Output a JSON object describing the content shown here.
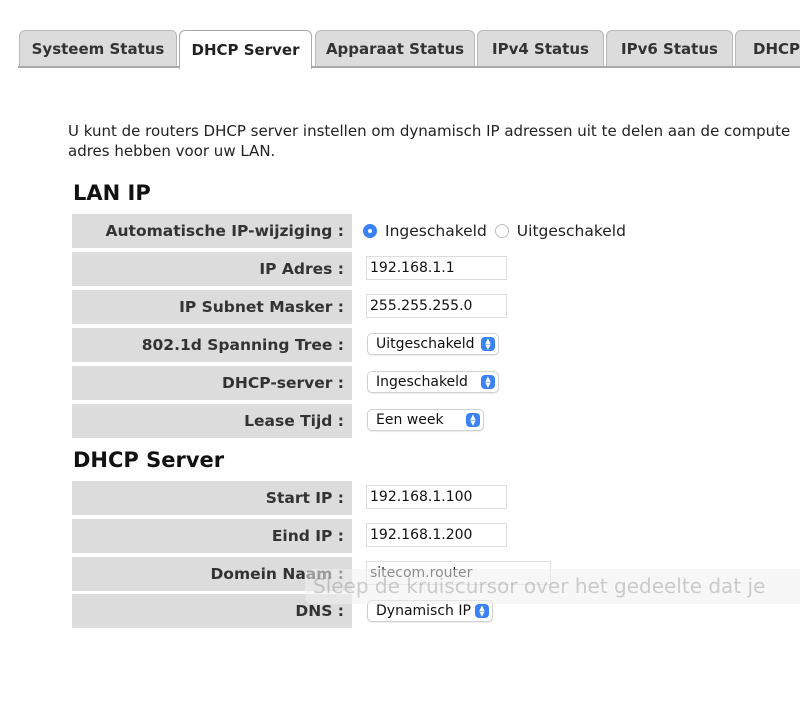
{
  "tabs": [
    {
      "label": "Systeem Status",
      "active": false
    },
    {
      "label": "DHCP Server",
      "active": true
    },
    {
      "label": "Apparaat Status",
      "active": false
    },
    {
      "label": "IPv4 Status",
      "active": false
    },
    {
      "label": "IPv6 Status",
      "active": false
    },
    {
      "label": "DHCP",
      "active": false
    }
  ],
  "intro": {
    "line1": "U kunt de routers DHCP server instellen om dynamisch IP adressen uit te delen aan de compute",
    "line2": "adres hebben voor uw LAN."
  },
  "lan_ip": {
    "title": "LAN IP",
    "auto_ip_label": "Automatische IP-wijziging :",
    "auto_ip_on": "Ingeschakeld",
    "auto_ip_off": "Uitgeschakeld",
    "ip_address_label": "IP Adres :",
    "ip_address_value": "192.168.1.1",
    "subnet_label": "IP Subnet Masker :",
    "subnet_value": "255.255.255.0",
    "spanning_tree_label": "802.1d Spanning Tree :",
    "spanning_tree_value": "Uitgeschakeld",
    "dhcp_server_label": "DHCP-server :",
    "dhcp_server_value": "Ingeschakeld",
    "lease_label": "Lease Tijd :",
    "lease_value": "Een week"
  },
  "dhcp_server": {
    "title": "DHCP Server",
    "start_ip_label": "Start IP :",
    "start_ip_value": "192.168.1.100",
    "end_ip_label": "Eind IP :",
    "end_ip_value": "192.168.1.200",
    "domain_label": "Domein Naam :",
    "domain_value": "sitecom.router",
    "dns_label": "DNS :",
    "dns_value": "Dynamisch IP"
  },
  "overlay_hint": "Sleep de kruiscursor over het gedeelte dat je",
  "colors": {
    "accent": "#3b82f6",
    "label_bg": "#dcdcdc",
    "tab_bg": "#dcdcdc"
  }
}
